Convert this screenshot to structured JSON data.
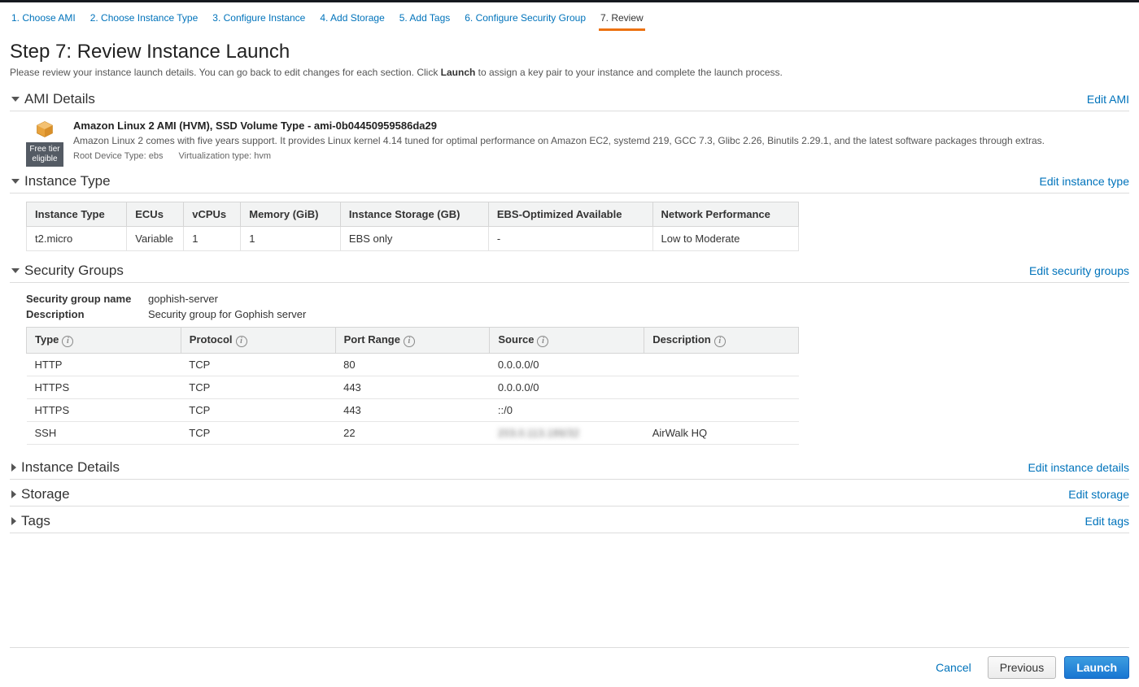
{
  "wizard": {
    "steps": [
      "1. Choose AMI",
      "2. Choose Instance Type",
      "3. Configure Instance",
      "4. Add Storage",
      "5. Add Tags",
      "6. Configure Security Group",
      "7. Review"
    ],
    "active_index": 6
  },
  "page": {
    "title": "Step 7: Review Instance Launch",
    "subtitle_pre": "Please review your instance launch details. You can go back to edit changes for each section. Click ",
    "subtitle_bold": "Launch",
    "subtitle_post": " to assign a key pair to your instance and complete the launch process."
  },
  "ami": {
    "section_title": "AMI Details",
    "edit_label": "Edit AMI",
    "title": "Amazon Linux 2 AMI (HVM), SSD Volume Type - ami-0b04450959586da29",
    "desc": "Amazon Linux 2 comes with five years support. It provides Linux kernel 4.14 tuned for optimal performance on Amazon EC2, systemd 219, GCC 7.3, Glibc 2.26, Binutils 2.29.1, and the latest software packages through extras.",
    "root_device": "Root Device Type: ebs",
    "virt_type": "Virtualization type: hvm",
    "free_tier_line1": "Free tier",
    "free_tier_line2": "eligible"
  },
  "instance_type": {
    "section_title": "Instance Type",
    "edit_label": "Edit instance type",
    "headers": [
      "Instance Type",
      "ECUs",
      "vCPUs",
      "Memory (GiB)",
      "Instance Storage (GB)",
      "EBS-Optimized Available",
      "Network Performance"
    ],
    "row": [
      "t2.micro",
      "Variable",
      "1",
      "1",
      "EBS only",
      "-",
      "Low to Moderate"
    ]
  },
  "security_groups": {
    "section_title": "Security Groups",
    "edit_label": "Edit security groups",
    "name_label": "Security group name",
    "name_value": "gophish-server",
    "desc_label": "Description",
    "desc_value": "Security group for Gophish server",
    "headers": [
      "Type",
      "Protocol",
      "Port Range",
      "Source",
      "Description"
    ],
    "rows": [
      {
        "type": "HTTP",
        "protocol": "TCP",
        "port": "80",
        "source": "0.0.0.0/0",
        "desc": ""
      },
      {
        "type": "HTTPS",
        "protocol": "TCP",
        "port": "443",
        "source": "0.0.0.0/0",
        "desc": ""
      },
      {
        "type": "HTTPS",
        "protocol": "TCP",
        "port": "443",
        "source": "::/0",
        "desc": ""
      },
      {
        "type": "SSH",
        "protocol": "TCP",
        "port": "22",
        "source": "203.0.113.186/32",
        "desc": "AirWalk HQ",
        "source_blurred": true
      }
    ]
  },
  "collapsed": {
    "instance_details": {
      "title": "Instance Details",
      "edit_label": "Edit instance details"
    },
    "storage": {
      "title": "Storage",
      "edit_label": "Edit storage"
    },
    "tags": {
      "title": "Tags",
      "edit_label": "Edit tags"
    }
  },
  "footer": {
    "cancel": "Cancel",
    "previous": "Previous",
    "launch": "Launch"
  }
}
